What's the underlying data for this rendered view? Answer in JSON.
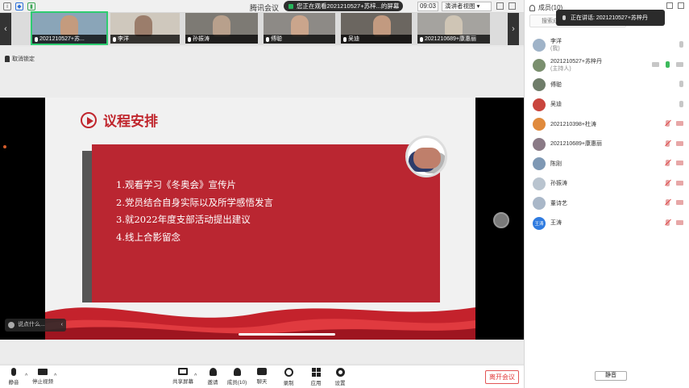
{
  "titlebar": {
    "app_title": "腾讯会议",
    "screen_share_notice": "您正在观看2021210527+苏梓...的屏幕",
    "meeting_time": "09:03",
    "view_mode": "演讲者视图"
  },
  "video_strip": {
    "tiles": [
      {
        "name": "2021210527+苏..."
      },
      {
        "name": "李洋"
      },
      {
        "name": "孙振涛"
      },
      {
        "name": "傅聪"
      },
      {
        "name": "吴迪"
      },
      {
        "name": "2021210689+康惠丽"
      }
    ]
  },
  "stage": {
    "pin_label": "取消锁定",
    "chat_hint": "说点什么..."
  },
  "slide": {
    "title": "议程安排",
    "items": [
      "1.观看学习《冬奥会》宣传片",
      "2.党员结合自身实际以及所学感悟发言",
      "3.就2022年度支部活动提出建议",
      "4.线上合影留念"
    ]
  },
  "toolbar": {
    "mute": "静音",
    "stop_video": "停止视频",
    "share_screen": "共享屏幕",
    "invite": "邀请",
    "members": "成员(10)",
    "chat": "聊天",
    "record": "录制",
    "apps": "应用",
    "settings": "设置",
    "leave": "离开会议"
  },
  "panel": {
    "title": "成员(10)",
    "search_placeholder": "搜索成员",
    "speaking": "正在讲话: 2021210527+苏梓丹",
    "mute_all": "静音",
    "members": [
      {
        "name": "李洋",
        "sub": "(我)",
        "avatar": "",
        "avatar_color": "#9fb3c8",
        "mic": "normal"
      },
      {
        "name": "2021210527+苏梓丹",
        "sub": "(主持人)",
        "avatar": "",
        "avatar_color": "#7a8f6e",
        "mic": "on"
      },
      {
        "name": "傅聪",
        "sub": "",
        "avatar": "",
        "avatar_color": "#6f7d6a",
        "mic": "normal"
      },
      {
        "name": "吴迪",
        "sub": "",
        "avatar": "",
        "avatar_color": "#c9453d",
        "mic": "normal"
      },
      {
        "name": "2021210398+杜涛",
        "sub": "",
        "avatar": "",
        "avatar_color": "#e08a3c",
        "mic": "muted"
      },
      {
        "name": "2021210689+康惠丽",
        "sub": "",
        "avatar": "",
        "avatar_color": "#8a7a86",
        "mic": "muted"
      },
      {
        "name": "陈刚",
        "sub": "",
        "avatar": "",
        "avatar_color": "#7e98b4",
        "mic": "muted"
      },
      {
        "name": "孙振涛",
        "sub": "",
        "avatar": "",
        "avatar_color": "#b9c4cf",
        "mic": "muted"
      },
      {
        "name": "董诗艺",
        "sub": "",
        "avatar": "",
        "avatar_color": "#a9b7c8",
        "mic": "muted"
      },
      {
        "name": "王涛",
        "sub": "",
        "avatar": "王涛",
        "avatar_color": "#2f7be0",
        "mic": "muted"
      }
    ]
  }
}
